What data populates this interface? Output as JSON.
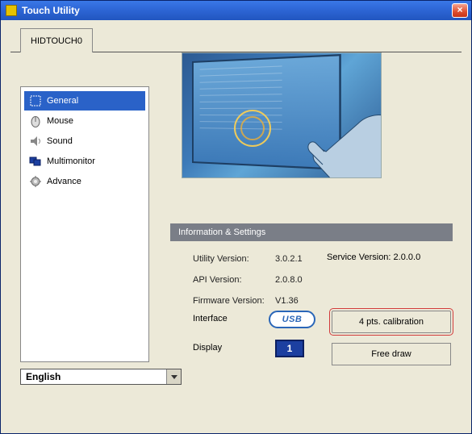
{
  "window": {
    "title": "Touch Utility"
  },
  "tabs": [
    "HIDTOUCH0"
  ],
  "sidebar": {
    "items": [
      {
        "label": "General",
        "selected": true,
        "icon": "general"
      },
      {
        "label": "Mouse",
        "selected": false,
        "icon": "mouse"
      },
      {
        "label": "Sound",
        "selected": false,
        "icon": "sound"
      },
      {
        "label": "Multimonitor",
        "selected": false,
        "icon": "multimonitor"
      },
      {
        "label": "Advance",
        "selected": false,
        "icon": "advance"
      }
    ]
  },
  "section_header": "Information & Settings",
  "info": {
    "utility_version_label": "Utility Version:",
    "utility_version_value": "3.0.2.1",
    "service_version_label": "Service Version:",
    "service_version_value": "2.0.0.0",
    "api_version_label": "API Version:",
    "api_version_value": "2.0.8.0",
    "firmware_version_label": "Firmware Version:",
    "firmware_version_value": "V1.36",
    "interface_label": "Interface",
    "interface_value": "USB",
    "display_label": "Display",
    "display_value": "1"
  },
  "buttons": {
    "calibration": "4 pts. calibration",
    "free_draw": "Free draw"
  },
  "language": {
    "selected": "English"
  }
}
